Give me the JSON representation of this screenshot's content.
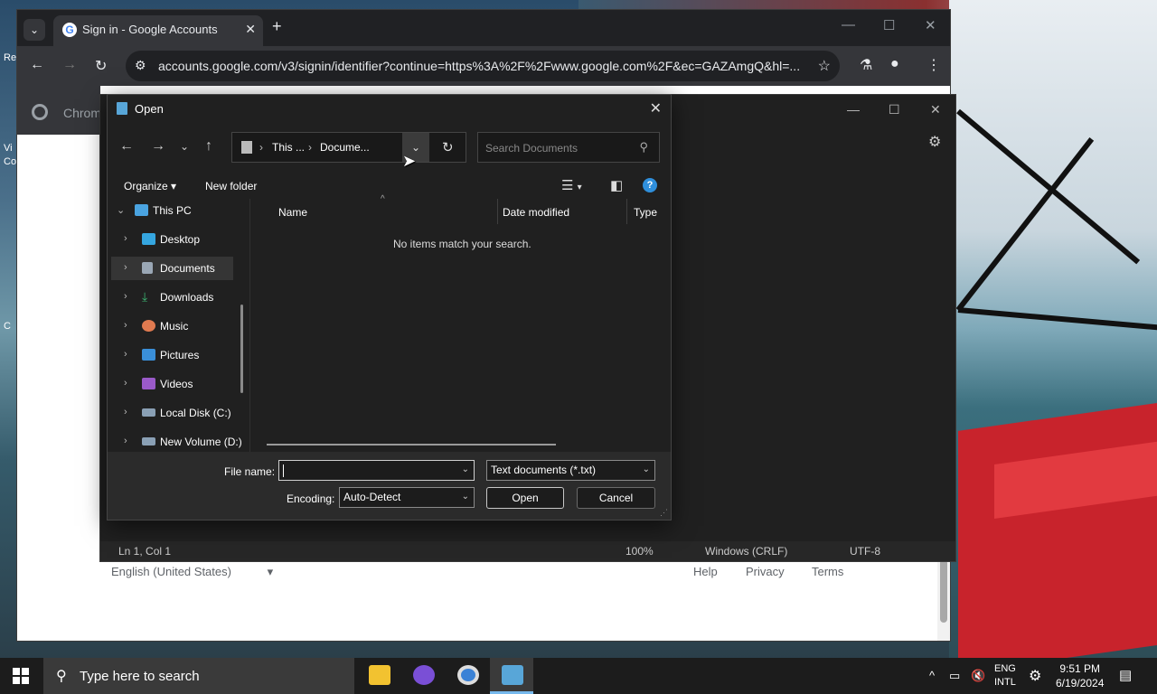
{
  "desktop": {
    "icon_labels": [
      "Re",
      "Vi",
      "Co",
      "C"
    ]
  },
  "chrome": {
    "tab_title": "Sign in - Google Accounts",
    "tab_favicon": "G",
    "url": "accounts.google.com/v3/signin/identifier?continue=https%3A%2F%2Fwww.google.com%2F&ec=GAZAmgQ&hl=...",
    "bookmark_text": "Chrom",
    "footer": {
      "language": "English (United States)",
      "links": [
        "Help",
        "Privacy",
        "Terms"
      ]
    }
  },
  "notepad": {
    "status": {
      "position": "Ln 1, Col 1",
      "zoom": "100%",
      "line_endings": "Windows (CRLF)",
      "encoding": "UTF-8"
    }
  },
  "dialog": {
    "title": "Open",
    "breadcrumb": [
      "This ...",
      "Docume..."
    ],
    "search_placeholder": "Search Documents",
    "organize_label": "Organize",
    "new_folder_label": "New folder",
    "tree": [
      {
        "label": "This PC",
        "icon": "monitor-icon",
        "color": "#4aa3e0"
      },
      {
        "label": "Desktop",
        "icon": "desktop-icon",
        "color": "#35a6e0"
      },
      {
        "label": "Documents",
        "icon": "documents-icon",
        "color": "#9aa7b5"
      },
      {
        "label": "Downloads",
        "icon": "download-icon",
        "color": "#3cb371"
      },
      {
        "label": "Music",
        "icon": "music-icon",
        "color": "#e07a50"
      },
      {
        "label": "Pictures",
        "icon": "pictures-icon",
        "color": "#3a8fd9"
      },
      {
        "label": "Videos",
        "icon": "videos-icon",
        "color": "#9a5ac9"
      },
      {
        "label": "Local Disk (C:)",
        "icon": "disk-icon",
        "color": "#8aa0b5"
      },
      {
        "label": "New Volume (D:)",
        "icon": "disk-icon",
        "color": "#8aa0b5"
      }
    ],
    "columns": [
      "Name",
      "Date modified",
      "Type"
    ],
    "empty_message": "No items match your search.",
    "file_name_label": "File name:",
    "file_name_value": "",
    "file_type": "Text documents (*.txt)",
    "encoding_label": "Encoding:",
    "encoding_value": "Auto-Detect",
    "open_button": "Open",
    "cancel_button": "Cancel"
  },
  "taskbar": {
    "search_placeholder": "Type here to search",
    "lang_line1": "ENG",
    "lang_line2": "INTL",
    "time": "9:51 PM",
    "date": "6/19/2024"
  }
}
